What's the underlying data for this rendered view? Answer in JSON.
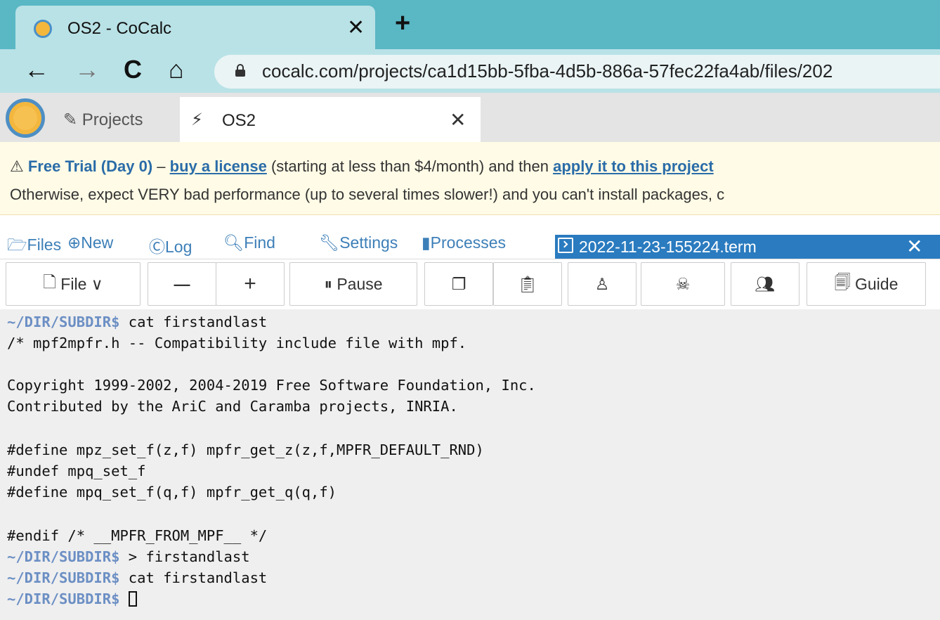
{
  "browser": {
    "tab_title": "OS2 - CoCalc",
    "tab_close": "✕",
    "new_tab": "+",
    "back": "←",
    "forward": "→",
    "reload": "C",
    "home": "⌂",
    "url": "cocalc.com/projects/ca1d15bb-5fba-4d5b-886a-57fec22fa4ab/files/202"
  },
  "cocalc": {
    "projects_label": "Projects",
    "project_tab_name": "OS2",
    "project_tab_close": "✕"
  },
  "banner": {
    "warn_icon": "⚠",
    "trial": "Free Trial (Day 0)",
    "dash": " – ",
    "buy_link": "buy a license",
    "middle": " (starting at less than $4/month) and then ",
    "apply_link": "apply it to this project",
    "line2": "Otherwise, expect VERY bad performance (up to several times slower!) and you can't install packages, c"
  },
  "subnav": {
    "files": "Files",
    "new": "New",
    "log": "Log",
    "find": "Find",
    "settings": "Settings",
    "processes": "Processes"
  },
  "terminal_tab": {
    "name": "2022-11-23-155224.term",
    "close": "✕"
  },
  "toolbar": {
    "file": "File",
    "minus": "—",
    "plus": "+",
    "pause": "Pause",
    "guide": "Guide"
  },
  "terminal": {
    "prompt": "~/DIR/SUBDIR$",
    "lines": [
      {
        "prompt": "~/DIR/SUBDIR$",
        "text": " cat firstandlast"
      },
      {
        "prompt": "",
        "text": "/* mpf2mpfr.h -- Compatibility include file with mpf."
      },
      {
        "prompt": "",
        "text": ""
      },
      {
        "prompt": "",
        "text": "Copyright 1999-2002, 2004-2019 Free Software Foundation, Inc."
      },
      {
        "prompt": "",
        "text": "Contributed by the AriC and Caramba projects, INRIA."
      },
      {
        "prompt": "",
        "text": ""
      },
      {
        "prompt": "",
        "text": "#define mpz_set_f(z,f) mpfr_get_z(z,f,MPFR_DEFAULT_RND)"
      },
      {
        "prompt": "",
        "text": "#undef mpq_set_f"
      },
      {
        "prompt": "",
        "text": "#define mpq_set_f(q,f) mpfr_get_q(q,f)"
      },
      {
        "prompt": "",
        "text": ""
      },
      {
        "prompt": "",
        "text": "#endif /* __MPFR_FROM_MPF__ */"
      },
      {
        "prompt": "~/DIR/SUBDIR$",
        "text": " > firstandlast"
      },
      {
        "prompt": "~/DIR/SUBDIR$",
        "text": " cat firstandlast"
      },
      {
        "prompt": "~/DIR/SUBDIR$",
        "text": " "
      }
    ]
  }
}
